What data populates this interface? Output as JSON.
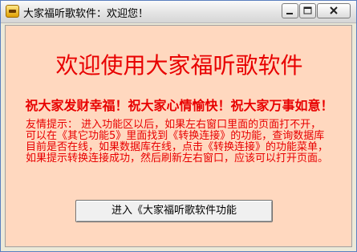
{
  "window": {
    "title": "大家福听歌软件：欢迎您！",
    "icon": "app-icon"
  },
  "main": {
    "headline": "欢迎使用大家福听歌软件",
    "blessing": "祝大家发财幸福！祝大家心情愉快！祝大家万事如意！",
    "tip": "友情提示： 进入功能区以后，如果左右窗口里面的页面打不开，可以在《其它功能5》里面找到《转换连接》的功能，查询数据库目前是否在线，如果数据库在线，点击《转换连接》的功能菜单，如果提示转换连接成功，然后刷新左右窗口，应该可以打开页面。",
    "enter_button": "进入《大家福听歌软件功能"
  },
  "colors": {
    "client_bg": "#ffd8bf",
    "text_red": "#e80000"
  }
}
